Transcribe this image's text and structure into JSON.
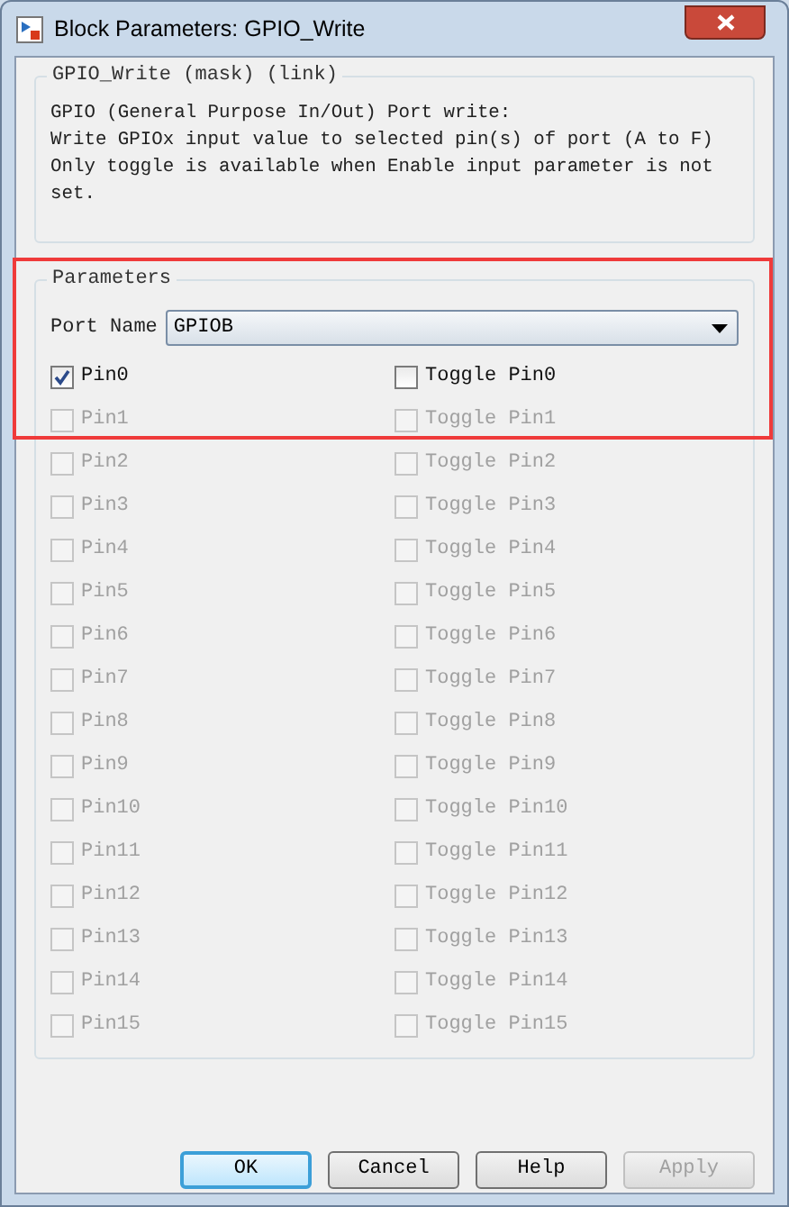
{
  "window": {
    "title": "Block Parameters: GPIO_Write"
  },
  "mask": {
    "title": "GPIO_Write (mask) (link)",
    "description": [
      "GPIO (General Purpose In/Out) Port write:",
      "Write GPIOx input value to selected pin(s) of port (A to F)",
      "Only toggle is available when Enable input parameter is not",
      "set."
    ]
  },
  "parameters": {
    "title": "Parameters",
    "port_label": "Port Name",
    "port_value": "GPIOB",
    "pins": [
      {
        "label": "Pin0",
        "checked": true,
        "disabled": false,
        "toggle": {
          "label": "Toggle Pin0",
          "checked": false,
          "disabled": false
        }
      },
      {
        "label": "Pin1",
        "checked": false,
        "disabled": true,
        "toggle": {
          "label": "Toggle Pin1",
          "checked": false,
          "disabled": true
        }
      },
      {
        "label": "Pin2",
        "checked": false,
        "disabled": true,
        "toggle": {
          "label": "Toggle Pin2",
          "checked": false,
          "disabled": true
        }
      },
      {
        "label": "Pin3",
        "checked": false,
        "disabled": true,
        "toggle": {
          "label": "Toggle Pin3",
          "checked": false,
          "disabled": true
        }
      },
      {
        "label": "Pin4",
        "checked": false,
        "disabled": true,
        "toggle": {
          "label": "Toggle Pin4",
          "checked": false,
          "disabled": true
        }
      },
      {
        "label": "Pin5",
        "checked": false,
        "disabled": true,
        "toggle": {
          "label": "Toggle Pin5",
          "checked": false,
          "disabled": true
        }
      },
      {
        "label": "Pin6",
        "checked": false,
        "disabled": true,
        "toggle": {
          "label": "Toggle Pin6",
          "checked": false,
          "disabled": true
        }
      },
      {
        "label": "Pin7",
        "checked": false,
        "disabled": true,
        "toggle": {
          "label": "Toggle Pin7",
          "checked": false,
          "disabled": true
        }
      },
      {
        "label": "Pin8",
        "checked": false,
        "disabled": true,
        "toggle": {
          "label": "Toggle Pin8",
          "checked": false,
          "disabled": true
        }
      },
      {
        "label": "Pin9",
        "checked": false,
        "disabled": true,
        "toggle": {
          "label": "Toggle Pin9",
          "checked": false,
          "disabled": true
        }
      },
      {
        "label": "Pin10",
        "checked": false,
        "disabled": true,
        "toggle": {
          "label": "Toggle Pin10",
          "checked": false,
          "disabled": true
        }
      },
      {
        "label": "Pin11",
        "checked": false,
        "disabled": true,
        "toggle": {
          "label": "Toggle Pin11",
          "checked": false,
          "disabled": true
        }
      },
      {
        "label": "Pin12",
        "checked": false,
        "disabled": true,
        "toggle": {
          "label": "Toggle Pin12",
          "checked": false,
          "disabled": true
        }
      },
      {
        "label": "Pin13",
        "checked": false,
        "disabled": true,
        "toggle": {
          "label": "Toggle Pin13",
          "checked": false,
          "disabled": true
        }
      },
      {
        "label": "Pin14",
        "checked": false,
        "disabled": true,
        "toggle": {
          "label": "Toggle Pin14",
          "checked": false,
          "disabled": true
        }
      },
      {
        "label": "Pin15",
        "checked": false,
        "disabled": true,
        "toggle": {
          "label": "Toggle Pin15",
          "checked": false,
          "disabled": true
        }
      }
    ]
  },
  "buttons": [
    {
      "label": "OK",
      "default": true,
      "disabled": false
    },
    {
      "label": "Cancel",
      "default": false,
      "disabled": false
    },
    {
      "label": "Help",
      "default": false,
      "disabled": false
    },
    {
      "label": "Apply",
      "default": false,
      "disabled": true
    }
  ]
}
